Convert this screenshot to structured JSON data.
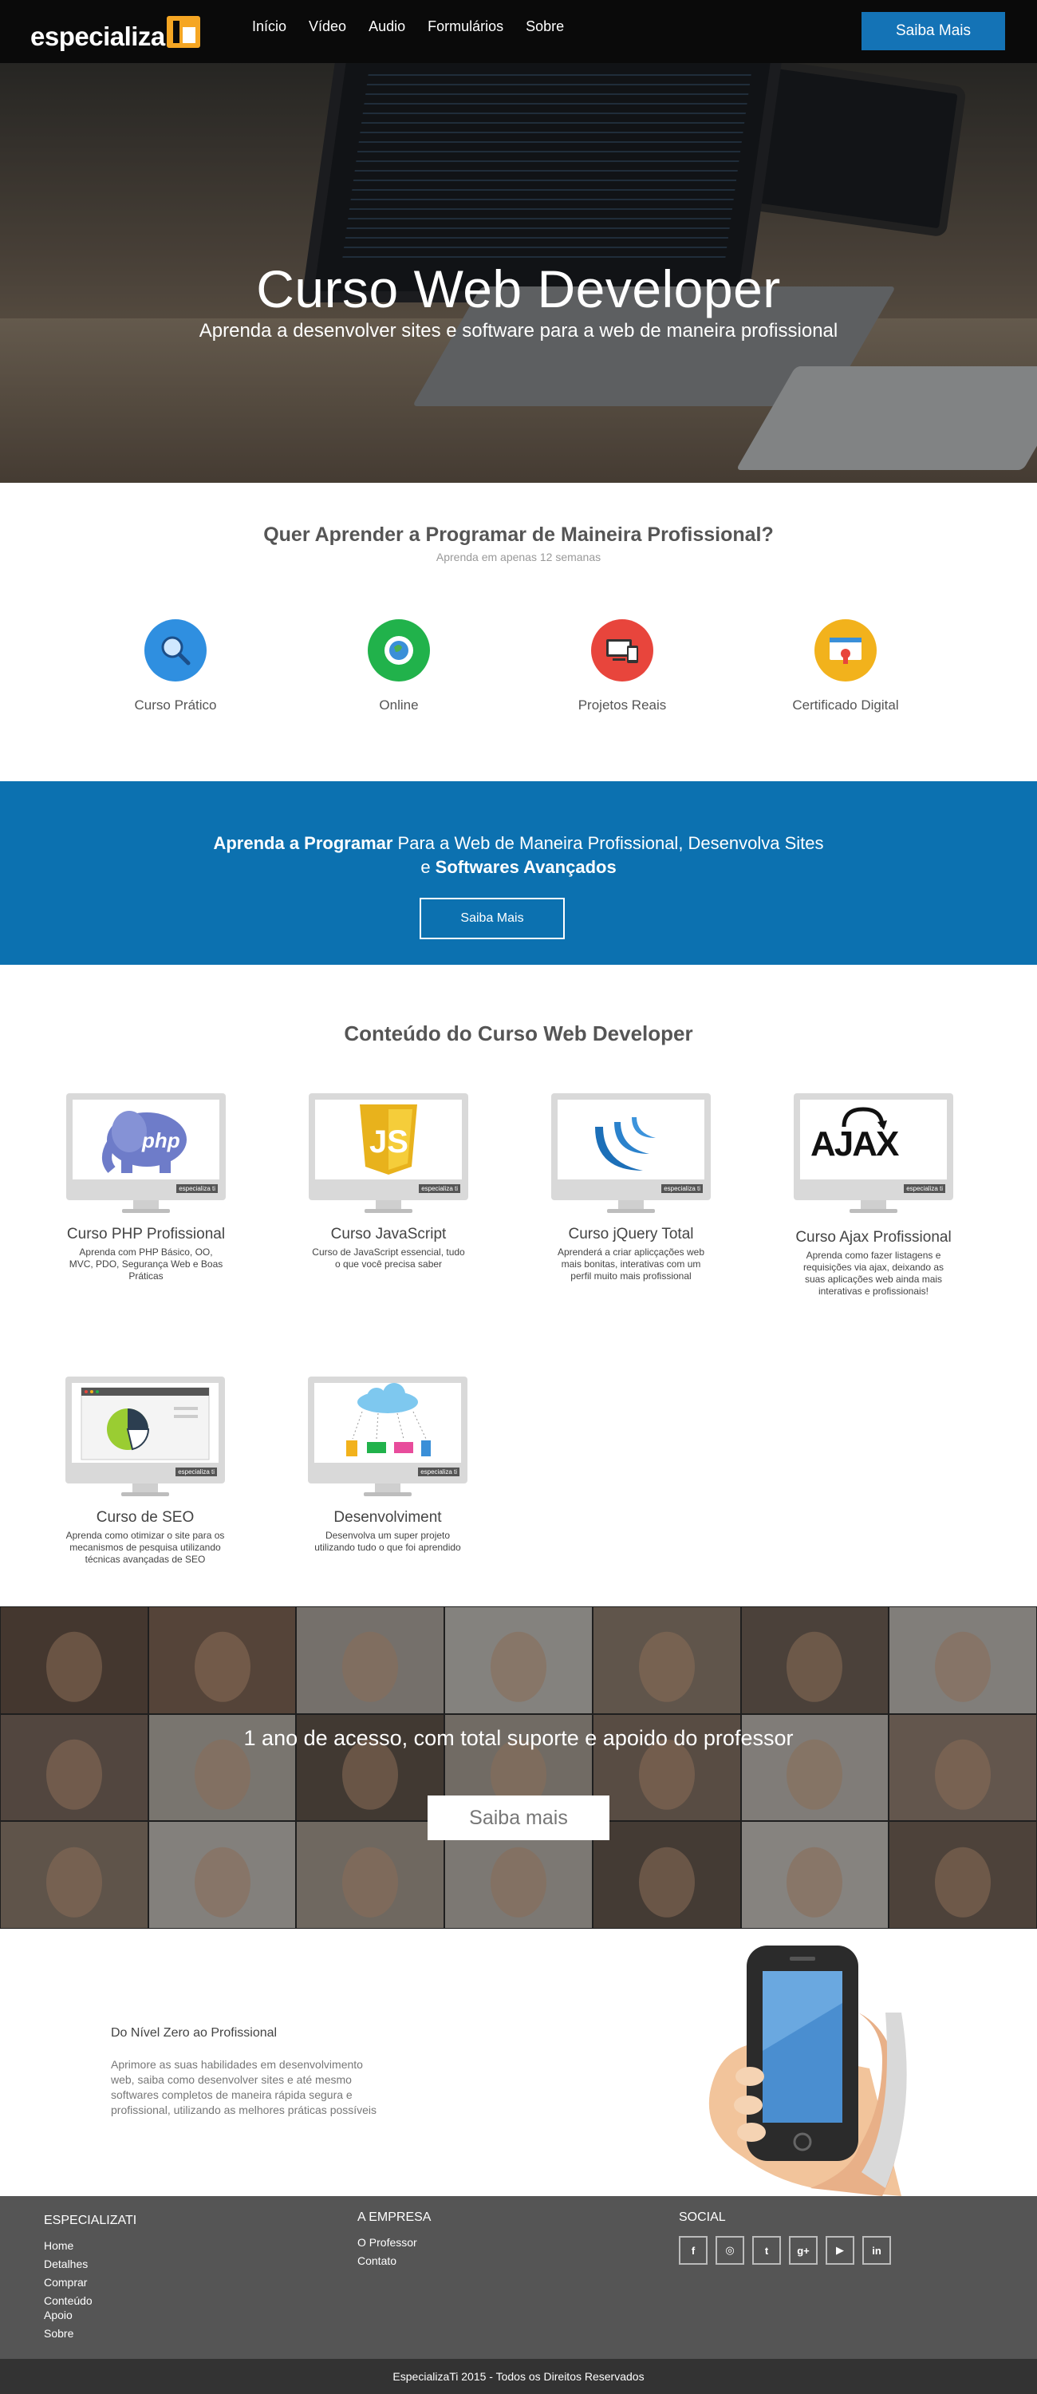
{
  "nav": {
    "logo": "especializa",
    "links": [
      "Início",
      "Vídeo",
      "Audio",
      "Formulários",
      "Sobre"
    ],
    "cta": "Saiba Mais"
  },
  "hero": {
    "title": "Curso Web Developer",
    "subtitle": "Aprenda a desenvolver sites e software para a web de maneira profissional"
  },
  "features": {
    "title": "Quer Aprender a Programar de Maineira Profissional?",
    "subtitle": "Aprenda em apenas 12 semanas",
    "items": [
      {
        "label": "Curso Prático",
        "icon": "magnifier-icon",
        "color": "#2f8fe0"
      },
      {
        "label": "Online",
        "icon": "globe-gear-icon",
        "color": "#21b24b"
      },
      {
        "label": "Projetos Reais",
        "icon": "devices-icon",
        "color": "#e8453c"
      },
      {
        "label": "Certificado Digital",
        "icon": "certificate-icon",
        "color": "#f2b21c"
      }
    ]
  },
  "band": {
    "bold1": "Aprenda a Programar",
    "text1": " Para a Web de Maneira Profissional, Desenvolva Sites",
    "text2": "e ",
    "bold2": "Softwares Avançados",
    "button": "Saiba Mais"
  },
  "courses": {
    "title": "Conteúdo do Curso Web Developer",
    "brand": "especializa ti",
    "items": [
      {
        "name": "Curso PHP Profissional",
        "desc": "Aprenda com PHP Básico, OO, MVC, PDO, Segurança Web e Boas Práticas",
        "icon": "php-elephant-icon"
      },
      {
        "name": "Curso JavaScript",
        "desc": "Curso de JavaScript essencial, tudo o que você precisa saber",
        "icon": "js-shield-icon"
      },
      {
        "name": "Curso jQuery Total",
        "desc": "Aprenderá a criar aplicçações web mais bonitas, interativas com um perfil muito mais profissional",
        "icon": "jquery-icon"
      },
      {
        "name": "Curso Ajax Profissional",
        "desc": "Aprenda como fazer listagens e requisições via ajax, deixando as suas aplicações web ainda mais interativas e profissionais!",
        "icon": "ajax-icon"
      },
      {
        "name": "Curso de SEO",
        "desc": "Aprenda como otimizar o site para os mecanismos de pesquisa utilizando técnicas avançadas de SEO",
        "icon": "seo-chart-icon"
      },
      {
        "name": "Desenvolviment",
        "desc": "Desenvolva um super projeto utilizando tudo o que foi aprendido",
        "icon": "cloud-devices-icon"
      }
    ]
  },
  "faces": {
    "text": "1 ano de acesso, com total suporte e apoido do professor",
    "button": "Saiba mais"
  },
  "promo": {
    "title": "Do Nível Zero ao Profissional",
    "text": "Aprimore as suas habilidades em desenvolvimento web, saiba como desenvolver sites e até mesmo softwares completos de maneira rápida segura e profissional, utilizando as melhores práticas possíveis"
  },
  "footer": {
    "col1": {
      "head": "ESPECIALIZATI",
      "links": [
        "Home",
        "Detalhes",
        "Comprar",
        "Conteúdo",
        "Apoio",
        "Sobre"
      ]
    },
    "col2": {
      "head": "A EMPRESA",
      "links": [
        "O Professor",
        "Contato"
      ]
    },
    "col3": {
      "head": "SOCIAL",
      "icons": [
        "f",
        "◎",
        "t",
        "g+",
        "▶",
        "in"
      ]
    },
    "copyright": "EspecializaTi 2015 - Todos os Direitos Reservados"
  }
}
